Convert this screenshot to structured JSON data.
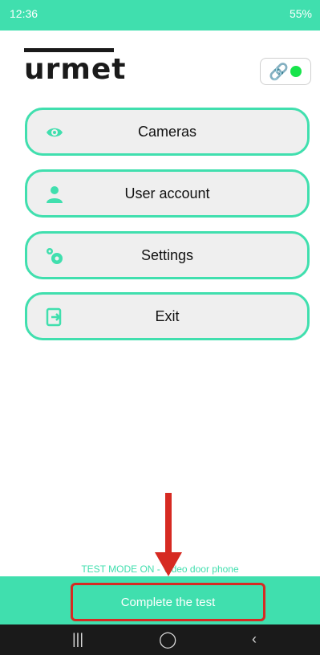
{
  "status": {
    "time": "12:36",
    "signal_label": "55%"
  },
  "brand": {
    "logo": "urmet"
  },
  "connection": {
    "link_icon": "link-icon",
    "status_color": "#17e44b"
  },
  "menu": [
    {
      "label": "Cameras",
      "icon": "eye-icon"
    },
    {
      "label": "User account",
      "icon": "user-icon"
    },
    {
      "label": "Settings",
      "icon": "gears-icon"
    },
    {
      "label": "Exit",
      "icon": "exit-icon"
    }
  ],
  "test": {
    "mode_text": "TEST MODE ON - Video door phone",
    "complete_label": "Complete the test"
  },
  "colors": {
    "accent": "#40dfae",
    "highlight": "#d62a22"
  }
}
